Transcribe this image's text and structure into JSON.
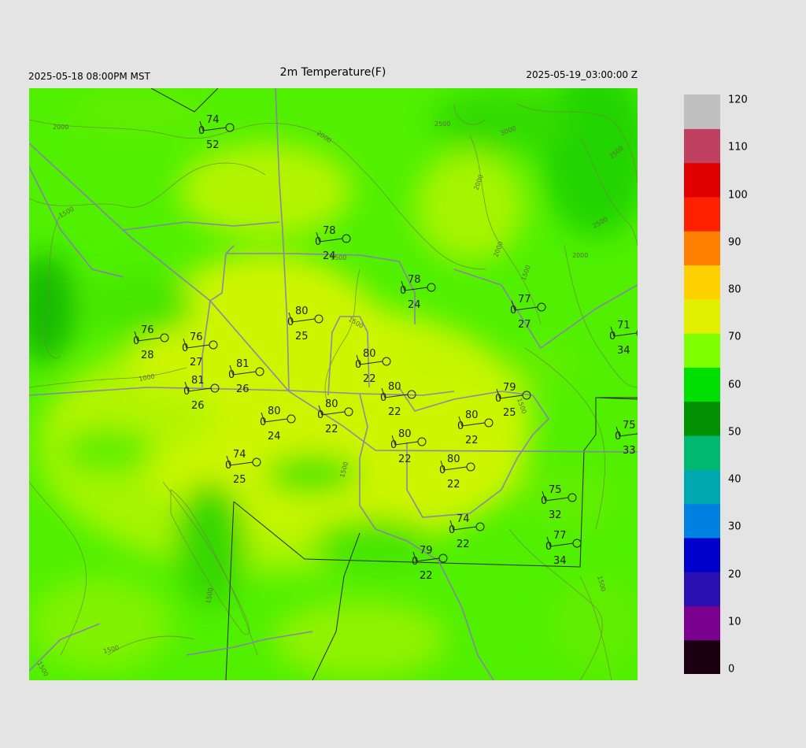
{
  "header": {
    "title": "2m Temperature(F)",
    "local_time": "2025-05-18 08:00PM MST",
    "utc_time": "2025-05-19_03:00:00 Z"
  },
  "colorbar": {
    "labels": [
      "120",
      "110",
      "100",
      "90",
      "80",
      "70",
      "60",
      "50",
      "40",
      "30",
      "20",
      "10",
      "0"
    ],
    "min": 0,
    "max": 120,
    "colors": [
      "#1a0010",
      "#7a0090",
      "#2a10b0",
      "#0000cc",
      "#0080e0",
      "#00a8b0",
      "#00b870",
      "#009000",
      "#00e000",
      "#80ff00",
      "#e0f000",
      "#ffd000",
      "#ff8000",
      "#ff2000",
      "#e00000",
      "#c04060",
      "#c0c0c0"
    ]
  },
  "contours": {
    "labels": [
      "2000",
      "2000",
      "2000",
      "1500",
      "1500",
      "2500",
      "3000",
      "2500",
      "2500",
      "2000",
      "1500",
      "1500",
      "2000",
      "1500",
      "1500",
      "1500",
      "1500",
      "1500",
      "1500",
      "1000"
    ]
  },
  "stations": [
    {
      "t": "74",
      "d": "52",
      "z": "0"
    },
    {
      "t": "78",
      "d": "24",
      "z": "0"
    },
    {
      "t": "78",
      "d": "24",
      "z": "0"
    },
    {
      "t": "77",
      "d": "27",
      "z": "0"
    },
    {
      "t": "76",
      "d": "28",
      "z": "0"
    },
    {
      "t": "76",
      "d": "27",
      "z": "0"
    },
    {
      "t": "80",
      "d": "25",
      "z": "0"
    },
    {
      "t": "80",
      "d": "22",
      "z": "0"
    },
    {
      "t": "71",
      "d": "34",
      "z": "0"
    },
    {
      "t": "81",
      "d": "26",
      "z": "0"
    },
    {
      "t": "81",
      "d": "26",
      "z": "0"
    },
    {
      "t": "80",
      "d": "22",
      "z": "0"
    },
    {
      "t": "79",
      "d": "25",
      "z": "0"
    },
    {
      "t": "80",
      "d": "24",
      "z": "0"
    },
    {
      "t": "80",
      "d": "22",
      "z": "0"
    },
    {
      "t": "80",
      "d": "22",
      "z": "0"
    },
    {
      "t": "80",
      "d": "22",
      "z": "0"
    },
    {
      "t": "75",
      "d": "33",
      "z": "0"
    },
    {
      "t": "74",
      "d": "25",
      "z": "0"
    },
    {
      "t": "80",
      "d": "22",
      "z": "0"
    },
    {
      "t": "75",
      "d": "32",
      "z": "0"
    },
    {
      "t": "74",
      "d": "22",
      "z": "0"
    },
    {
      "t": "77",
      "d": "34",
      "z": "0"
    },
    {
      "t": "79",
      "d": "22",
      "z": "0"
    }
  ]
}
